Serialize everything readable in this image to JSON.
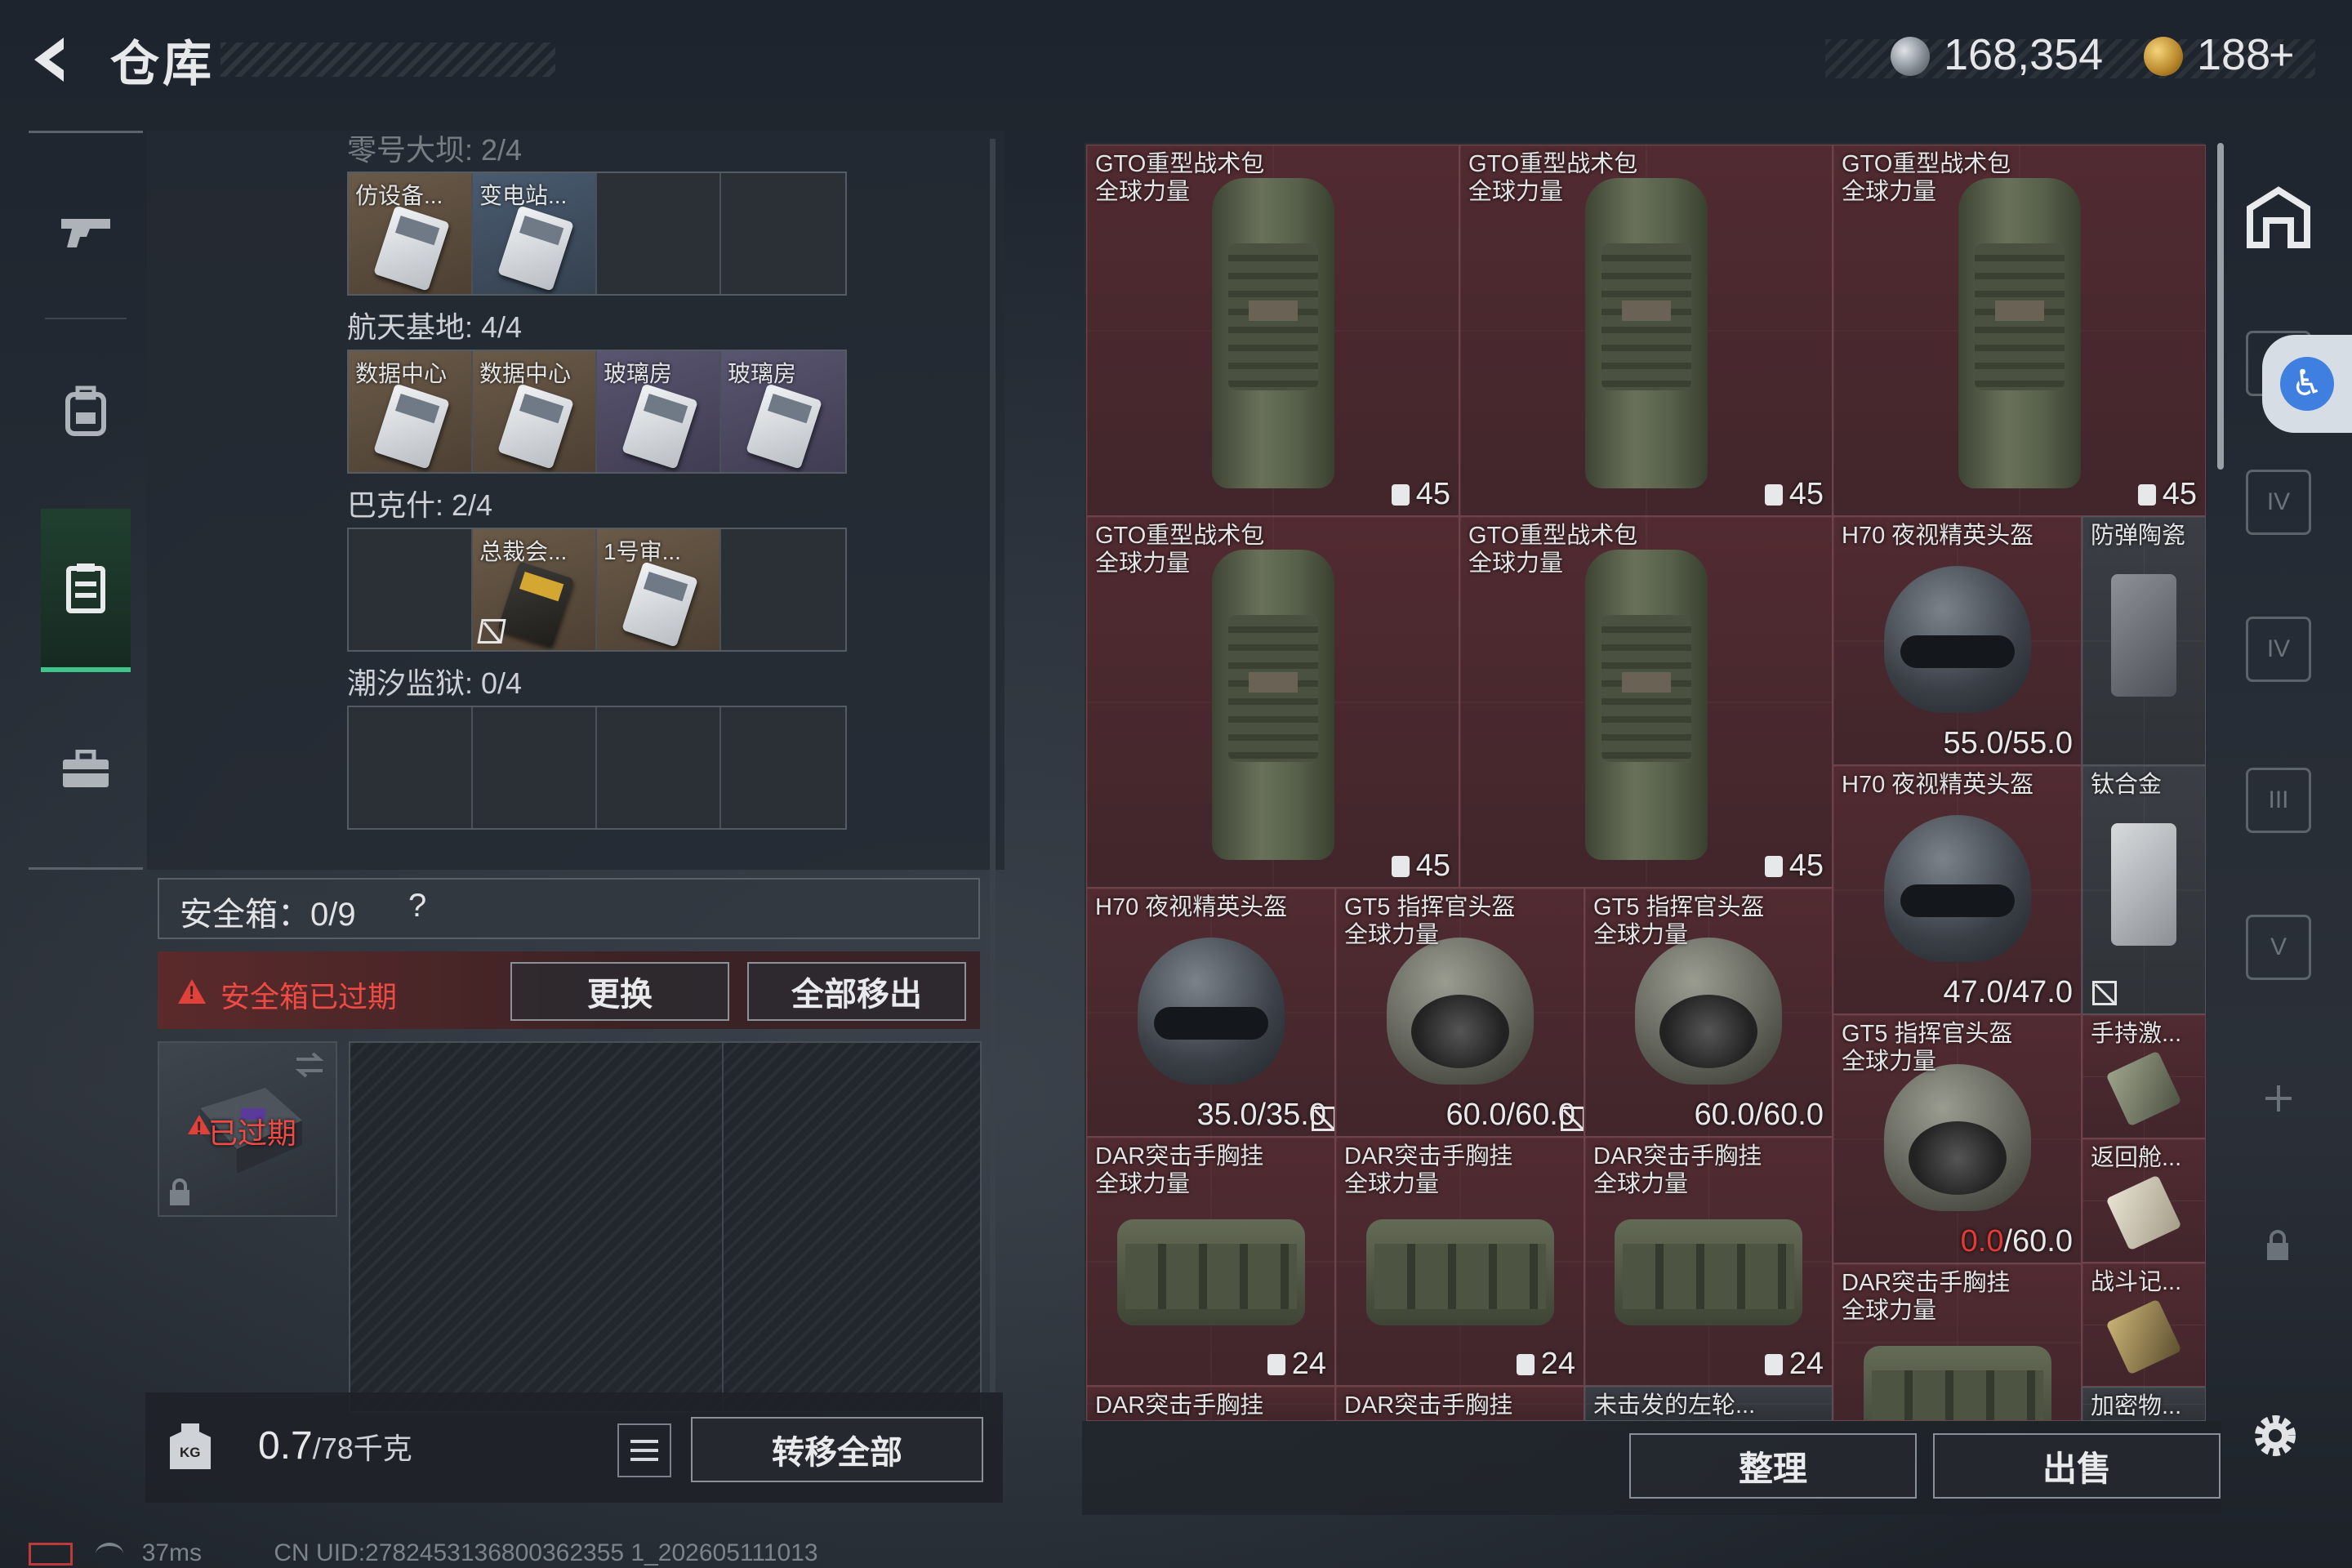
{
  "header": {
    "title": "仓库",
    "currency1": "168,354",
    "currency2": "188",
    "currency2_plus": "+"
  },
  "key_sections": [
    {
      "label": "零号大坝: 2/4",
      "keys": [
        "仿设备...",
        "变电站...",
        "",
        ""
      ]
    },
    {
      "label": "航天基地: 4/4",
      "keys": [
        "数据中心",
        "数据中心",
        "玻璃房",
        "玻璃房"
      ]
    },
    {
      "label": "巴克什: 2/4",
      "keys": [
        "",
        "总裁会...",
        "1号审...",
        ""
      ]
    },
    {
      "label": "潮汐监狱: 0/4",
      "keys": [
        "",
        "",
        "",
        ""
      ]
    }
  ],
  "safe_box": {
    "title": "安全箱：",
    "count": "0/9",
    "help": "?",
    "expired_text": "安全箱已过期",
    "replace_btn": "更换",
    "remove_all_btn": "全部移出",
    "item_expired_label": "已过期"
  },
  "weight": {
    "current": "0.7",
    "capacity": "/78千克",
    "transfer_btn": "转移全部"
  },
  "status": {
    "latency": "37ms",
    "uid": "CN UID:2782453136800362355 1_202605111013"
  },
  "inventory": {
    "items": [
      {
        "name": "GTO重型战术包",
        "sub": "全球力量",
        "val": "45"
      },
      {
        "name": "GTO重型战术包",
        "sub": "全球力量",
        "val": "45"
      },
      {
        "name": "GTO重型战术包",
        "sub": "全球力量",
        "val": "45"
      },
      {
        "name": "GTO重型战术包",
        "sub": "全球力量",
        "val": "45"
      },
      {
        "name": "GTO重型战术包",
        "sub": "全球力量",
        "val": "45"
      },
      {
        "name": "H70 夜视精英头盔",
        "val": "55.0/55.0"
      },
      {
        "name": "防弹陶瓷"
      },
      {
        "name": "H70 夜视精英头盔",
        "val": "47.0/47.0"
      },
      {
        "name": "钛合金"
      },
      {
        "name": "H70 夜视精英头盔",
        "val": "35.0/35.0"
      },
      {
        "name": "GT5 指挥官头盔",
        "sub": "全球力量",
        "val": "60.0/60.0"
      },
      {
        "name": "GT5 指挥官头盔",
        "sub": "全球力量",
        "val": "60.0/60.0"
      },
      {
        "name": "GT5 指挥官头盔",
        "sub": "全球力量",
        "val_red": "0.0",
        "val_rest": "/60.0"
      },
      {
        "name": "手持激..."
      },
      {
        "name": "返回舱..."
      },
      {
        "name": "DAR突击手胸挂",
        "sub": "全球力量",
        "val": "24"
      },
      {
        "name": "DAR突击手胸挂",
        "sub": "全球力量",
        "val": "24"
      },
      {
        "name": "DAR突击手胸挂",
        "sub": "全球力量",
        "val": "24"
      },
      {
        "name": "DAR突击手胸挂",
        "sub": "全球力量"
      },
      {
        "name": "战斗记..."
      },
      {
        "name": "DAR突击手胸挂"
      },
      {
        "name": "DAR突击手胸挂"
      },
      {
        "name": "未击发的左轮..."
      },
      {
        "name": "加密物..."
      }
    ],
    "sort_btn": "整理",
    "sell_btn": "出售"
  },
  "colors": {
    "accent_green": "#3fc58a",
    "warn_red": "#ef4a44",
    "item_red_bg": "#512b31"
  }
}
